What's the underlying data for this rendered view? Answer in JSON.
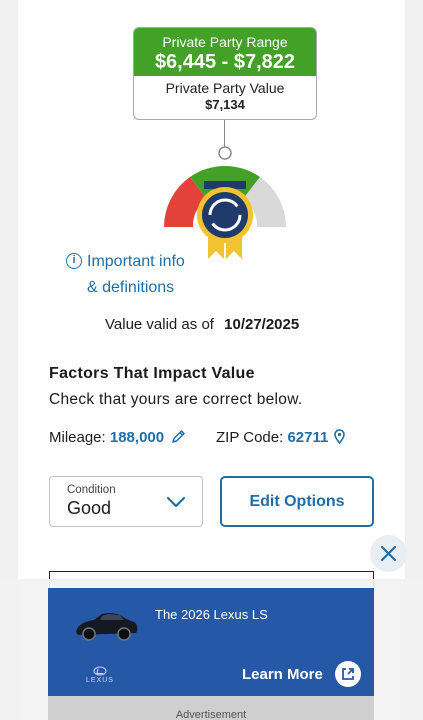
{
  "price": {
    "range_label": "Private Party Range",
    "range_value": "$6,445 - $7,822",
    "value_label": "Private Party Value",
    "value_amount": "$7,134"
  },
  "info_link": {
    "line1": "Important info",
    "line2": "& definitions",
    "icon": "info-icon"
  },
  "valid": {
    "label": "Value valid as of",
    "date": "10/27/2025"
  },
  "factors": {
    "title": "Factors That Impact Value",
    "subtitle": "Check that yours are correct below."
  },
  "vehicle": {
    "mileage_label": "Mileage:",
    "mileage_value": "188,000",
    "zip_label": "ZIP Code:",
    "zip_value": "62711"
  },
  "condition": {
    "label": "Condition",
    "value": "Good"
  },
  "edit_options": {
    "label": "Edit Options"
  },
  "ad": {
    "title": "The 2026 Lexus LS",
    "brand": "LEXUS",
    "cta": "Learn More",
    "label": "Advertisement"
  },
  "colors": {
    "green": "#43a127",
    "blue_link": "#1e6fa8",
    "ad_blue": "#2658a8",
    "gauge_red": "#e5413b",
    "badge_navy": "#1f3b6b",
    "badge_gold": "#f2c230"
  }
}
